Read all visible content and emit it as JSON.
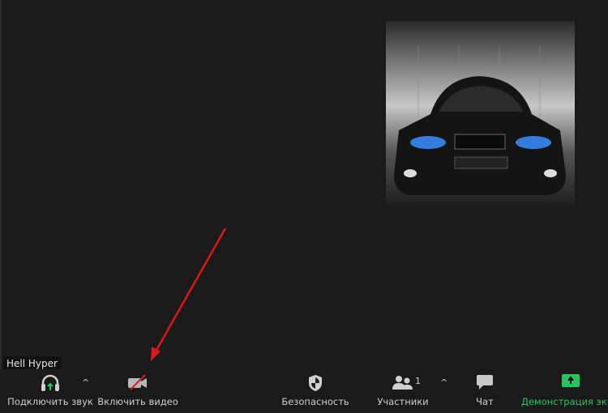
{
  "participant_name": "Hell Hyper",
  "toolbar": {
    "audio_label": "Подключить звук",
    "video_label": "Включить видео",
    "security_label": "Безопасность",
    "participants_label": "Участники",
    "participants_count": "1",
    "chat_label": "Чат",
    "share_label": "Демонстрация экрана"
  },
  "colors": {
    "background": "#1a1a1a",
    "accent_green": "#22c55e",
    "annotation_red": "#e0161b"
  }
}
